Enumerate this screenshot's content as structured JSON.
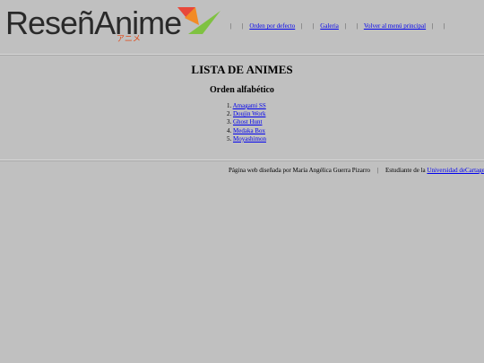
{
  "logo": {
    "text": "ReseñAnime",
    "subtitle": "アニメ",
    "colors": {
      "red": "#e8483a",
      "orange": "#f28b25",
      "green": "#7fc241"
    }
  },
  "nav": {
    "separator": "|",
    "items": [
      {
        "label": "Orden por defecto"
      },
      {
        "label": "Galeria"
      },
      {
        "label": "Volver al menú principal"
      }
    ]
  },
  "main": {
    "title": "LISTA DE ANIMES",
    "subtitle": "Orden alfabético",
    "list": [
      {
        "number": "1.",
        "label": "Amagami SS"
      },
      {
        "number": "2.",
        "label": "Doujin Work"
      },
      {
        "number": "3.",
        "label": "Ghost Hunt"
      },
      {
        "number": "4.",
        "label": "Medaka Box"
      },
      {
        "number": "5.",
        "label": "Moyashimon"
      }
    ]
  },
  "footer": {
    "credit": "Página web diseñada por María Angélica Guerra Pizarro",
    "separator": "|",
    "student_prefix": "Estudiante de la",
    "university_link_1": "Universidad de",
    "university_link_2": "Cartagena"
  },
  "colors": {
    "background": "#c0c0c0",
    "link": "#0000ee"
  }
}
